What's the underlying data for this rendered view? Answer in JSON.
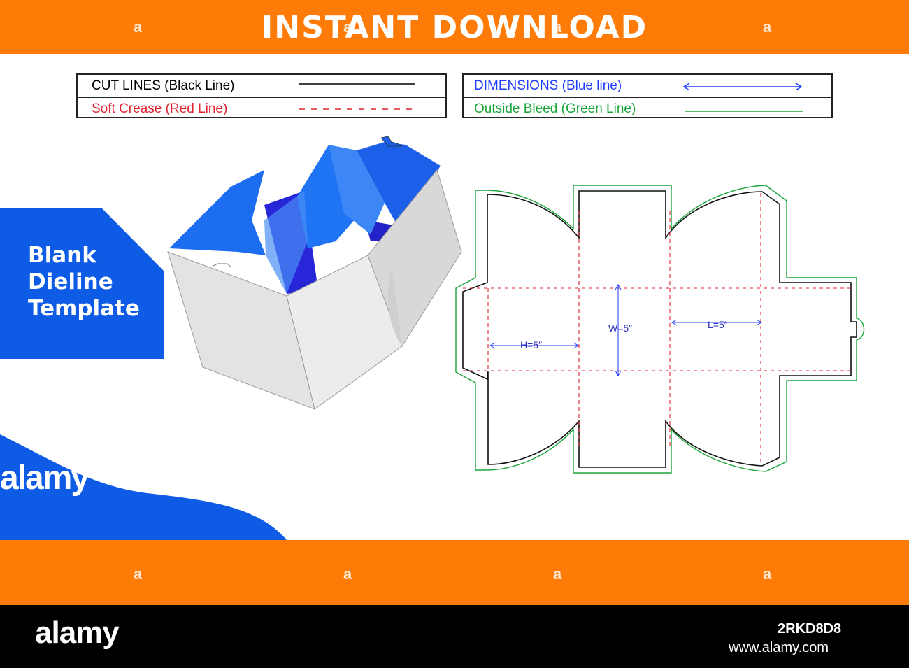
{
  "banner": {
    "title": "INSTANT DOWNLOAD",
    "watermark": "a"
  },
  "legend": {
    "cut_lines": "CUT LINES (Black Line)",
    "soft_crease": "Soft Crease (Red Line)",
    "dimensions": "DIMENSIONS (Blue line)",
    "outside_bleed": "Outside Bleed (Green Line)"
  },
  "blank_panel": {
    "line1": "Blank",
    "line2": "Dieline",
    "line3": "Template"
  },
  "dieline": {
    "h_label": "H=5″",
    "w_label": "W=5″",
    "l_label": "L=5″"
  },
  "side_watermark": "alamy",
  "footer": {
    "logo": "alamy",
    "image_id": "2RKD8D8",
    "url": "www.alamy.com"
  },
  "colors": {
    "orange": "#ff7b07",
    "blue": "#0e5be6",
    "cut": "#000000",
    "crease": "#e0232e",
    "dimension": "#1e3cff",
    "bleed": "#18a53a"
  }
}
